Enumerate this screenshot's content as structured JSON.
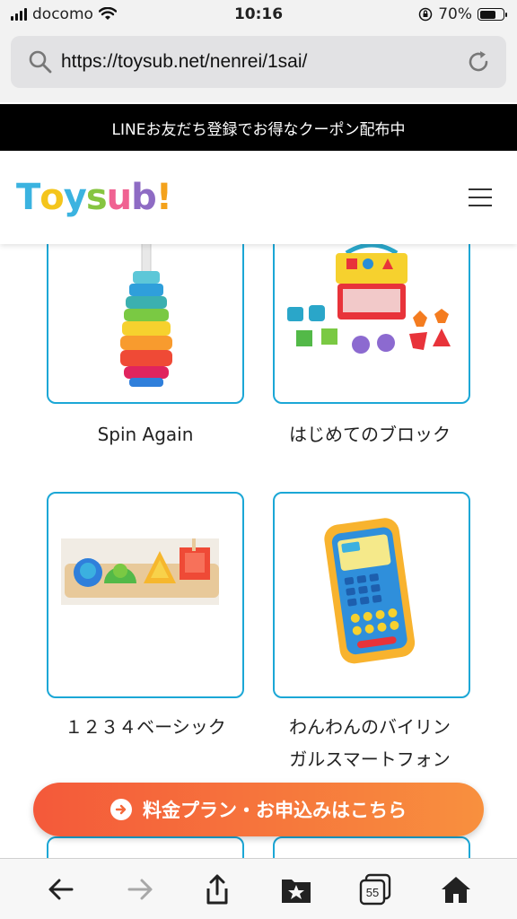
{
  "status": {
    "carrier": "docomo",
    "time": "10:16",
    "battery": "70%",
    "battery_level": 0.7
  },
  "browser": {
    "url": "https://toysub.net/nenrei/1sai/",
    "tab_count": "55"
  },
  "banner": {
    "text": "LINEお友だち登録でお得なクーポン配布中"
  },
  "header": {
    "logo_letters": [
      "T",
      "o",
      "y",
      "s",
      "u",
      "b",
      "!"
    ],
    "logo_colors": [
      "#3bb3e0",
      "#f4c51c",
      "#3bb3e0",
      "#86c540",
      "#f06292",
      "#8e6bc4",
      "#f4a21c"
    ]
  },
  "products": [
    {
      "name": "Spin Again",
      "image": "spin-again-stacking-toy"
    },
    {
      "name": "はじめてのブロック",
      "image": "shape-sorter-bucket"
    },
    {
      "name": "１２３４ベーシック",
      "image": "wooden-shape-puzzle"
    },
    {
      "name_line1": "わんわんのバイリン",
      "name_line2": "ガルスマートフォン",
      "image": "toy-smartphone"
    }
  ],
  "cta": {
    "label": "料金プラン・お申込みはこちら"
  },
  "icons": {
    "search": "search-icon",
    "reload": "reload-icon",
    "menu": "hamburger-menu-icon",
    "back": "back-arrow-icon",
    "forward": "forward-arrow-icon",
    "share": "share-icon",
    "bookmarks": "bookmarks-icon",
    "tabs": "tabs-icon",
    "home": "home-icon"
  },
  "colors": {
    "accent": "#1ba7d6",
    "cta_start": "#f4593a",
    "cta_end": "#f8903e"
  }
}
